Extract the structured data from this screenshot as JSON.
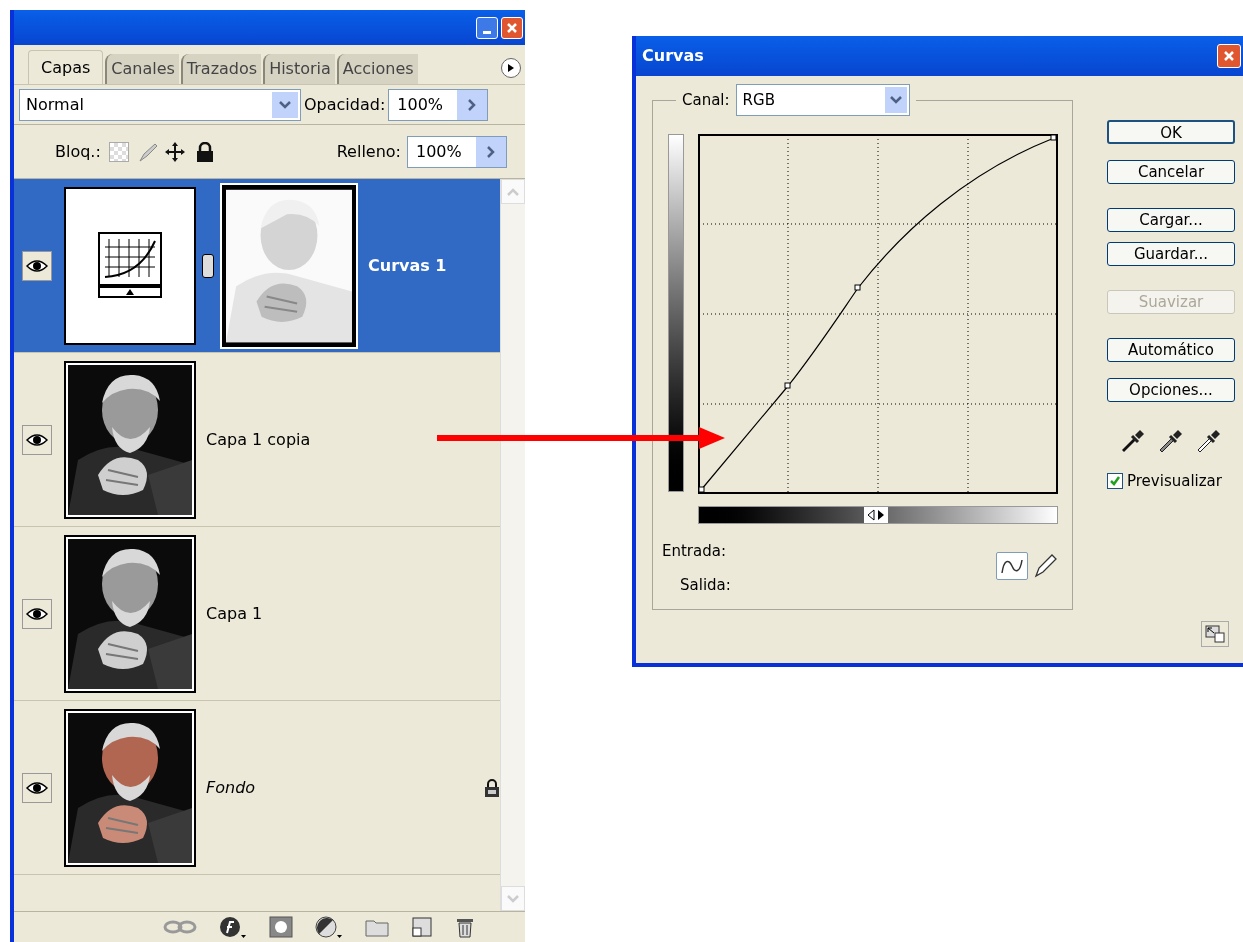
{
  "layers_panel": {
    "tabs": [
      {
        "label": "Capas",
        "selected": true
      },
      {
        "label": "Canales",
        "selected": false
      },
      {
        "label": "Trazados",
        "selected": false
      },
      {
        "label": "Historia",
        "selected": false
      },
      {
        "label": "Acciones",
        "selected": false
      }
    ],
    "blend_mode": "Normal",
    "opacity": {
      "label": "Opacidad:",
      "value": "100%"
    },
    "lock": {
      "label": "Bloq.:"
    },
    "fill": {
      "label": "Relleno:",
      "value": "100%"
    },
    "layers": [
      {
        "name": "Curvas 1",
        "kind": "adjustment",
        "visible": true,
        "selected": true
      },
      {
        "name": "Capa 1 copia",
        "visible": true,
        "selected": false
      },
      {
        "name": "Capa 1",
        "visible": true,
        "selected": false
      },
      {
        "name": "Fondo",
        "kind": "background",
        "visible": true,
        "selected": false
      }
    ]
  },
  "curves_dialog": {
    "title": "Curvas",
    "channel": {
      "label": "Canal:",
      "value": "RGB"
    },
    "buttons": [
      {
        "label": "OK",
        "disabled": false,
        "default": true
      },
      {
        "label": "Cancelar",
        "disabled": false,
        "default": false
      },
      {
        "label": "Cargar...",
        "disabled": false,
        "default": false
      },
      {
        "label": "Guardar...",
        "disabled": false,
        "default": false
      },
      {
        "label": "Suavizar",
        "disabled": true,
        "default": false
      },
      {
        "label": "Automático",
        "disabled": false,
        "default": false
      },
      {
        "label": "Opciones...",
        "disabled": false,
        "default": false
      }
    ],
    "input_label": "Entrada:",
    "output_label": "Salida:",
    "preview": {
      "label": "Previsualizar",
      "checked": true
    }
  }
}
